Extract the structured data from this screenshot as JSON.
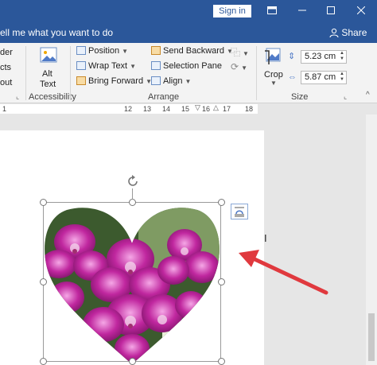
{
  "titlebar": {
    "signin_label": "Sign in",
    "buttons": [
      "restore-ribbon",
      "minimize",
      "maximize",
      "close"
    ]
  },
  "tellbar": {
    "tell_me": "ell me what you want to do",
    "share": "Share"
  },
  "ribbon": {
    "left_cut": [
      "der",
      "cts",
      "out"
    ],
    "accessibility": {
      "alt_text_line1": "Alt",
      "alt_text_line2": "Text",
      "group": "Accessibility"
    },
    "arrange": {
      "position": "Position",
      "wrap_text": "Wrap Text",
      "bring_forward": "Bring Forward",
      "send_backward": "Send Backward",
      "selection_pane": "Selection Pane",
      "align": "Align",
      "group": "Arrange"
    },
    "size": {
      "crop": "Crop",
      "height": "5.23 cm",
      "width": "5.87 cm",
      "group": "Size"
    }
  },
  "ruler": {
    "numbers": [
      "1",
      "12",
      "13",
      "14",
      "15",
      "16",
      "17",
      "18"
    ]
  },
  "colors": {
    "title_bar": "#2b579a",
    "arrow": "#e0393e",
    "orchid": "#c0279f"
  },
  "icons": [
    "restore-icon",
    "minimize-icon",
    "maximize-icon",
    "close-icon",
    "user-icon",
    "alt-text-icon",
    "position-icon",
    "wrap-text-icon",
    "bring-forward-icon",
    "send-backward-icon",
    "selection-pane-icon",
    "align-icon",
    "group-icon",
    "rotate-icon",
    "crop-icon",
    "height-icon",
    "width-icon",
    "dialog-launcher-icon",
    "layout-options-icon",
    "resize-cursor-icon",
    "arrow-annotation"
  ]
}
